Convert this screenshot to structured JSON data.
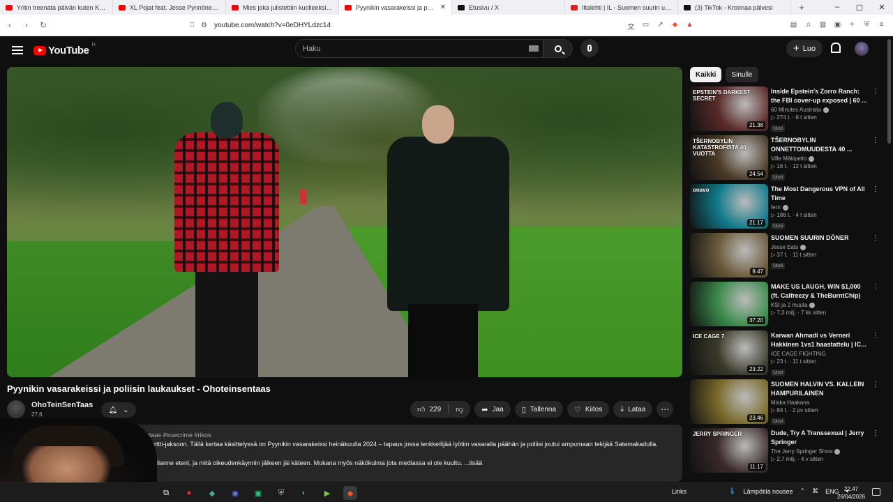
{
  "browser": {
    "tabs": [
      {
        "label": "Yritin treenata päivän kuten Klesbo -",
        "color": "#f00",
        "active": false
      },
      {
        "label": "XL Pojat feat. Jesse Pynnönen - You",
        "color": "#f00",
        "active": false
      },
      {
        "label": "Mies joka julistettiin kuolleeksi - mu",
        "color": "#f00",
        "active": false
      },
      {
        "label": "Pyynikin vasarakeissi ja polis",
        "color": "#f00",
        "active": true
      },
      {
        "label": "Etusivu / X",
        "color": "#111",
        "active": false
      },
      {
        "label": "Iltalehti | IL - Suomen suurin uutispal",
        "color": "#d22",
        "active": false
      },
      {
        "label": "(3) TikTok - Kroonaa pälvesi",
        "color": "#111",
        "active": false
      }
    ],
    "url": "youtube.com/watch?v=0eDHYLdzc14"
  },
  "masthead": {
    "logo_text": "YouTube",
    "region": "FI",
    "search_placeholder": "Haku",
    "create_label": "Luo"
  },
  "video": {
    "title": "Pyynikin vasarakeissi ja poliisin laukaukset - Ohoteinsentaas",
    "channel": "OhoTeinSenTaas",
    "subs": "27,6",
    "likes": "229",
    "share": "Jaa",
    "save": "Tallenna",
    "thanks": "Kiitos",
    "download": "Lataa",
    "desc_line1": "teinsentaas #truecrime #rikos",
    "desc_line2": "aporttti-jaksoon. Tällä kertaa käsittelyssä on Pyynikin vasarakeissi heinäkuulta 2024 – tapaus jossa lenkkeilijää lyötiin vasaralla päähän ja poliisi joutui ampumaan tekijää Satamakadulla.",
    "desc_line3": "en tilanne eteni, ja mitä oikeudenkäynnin jälkeen jäi käteen. Mukana myös näkökulma jota mediassa ei ole kuultu. ...lisää"
  },
  "chips": [
    "Kaikki",
    "Sinulle"
  ],
  "recommendations": [
    {
      "title": "Inside Epstein's Zorro Ranch: the FBI cover-up exposed | 60 ...",
      "channel": "60 Minutes Australia",
      "verified": true,
      "meta": "274 t. · 8 t sitten",
      "badge": "Uusi",
      "duration": "21.38",
      "thumb_text": "EPSTEIN'S DARKEST SECRET",
      "bg": "#5a2a2a"
    },
    {
      "title": "TŠERNOBYLIN ONNETTOMUUDESTA 40 ...",
      "channel": "Ville Mäkipelto",
      "verified": true,
      "meta": "16 t. · 12 t sitten",
      "badge": "Uusi",
      "duration": "24.54",
      "thumb_text": "TŠERNOBYLIN KATASTROFISTA 40 VUOTTA",
      "bg": "#4a3a26"
    },
    {
      "title": "The Most Dangerous VPN of All Time",
      "channel": "fern",
      "verified": true,
      "meta": "186 t. · 4 t sitten",
      "badge": "Uusi",
      "duration": "21.17",
      "thumb_text": "onavo",
      "bg": "#0f7a8a"
    },
    {
      "title": "SUOMEN SUURIN DÖNER",
      "channel": "Jesse Eats",
      "verified": true,
      "meta": "37 t. · 11 t sitten",
      "badge": "Uusi",
      "duration": "9.47",
      "thumb_text": "",
      "bg": "#6a5a3a"
    },
    {
      "title": "MAKE US LAUGH, WIN $1,000 (ft. Calfreezy & TheBurntChip)",
      "channel": "KSI ja 2 muuta",
      "verified": true,
      "meta": "7,3 milj. · 7 kk sitten",
      "badge": "",
      "duration": "37.20",
      "thumb_text": "",
      "bg": "#3a8a4a"
    },
    {
      "title": "Karwan Ahmadi vs Verneri Hakkinen 1vs1 haastattelu | IC...",
      "channel": "ICE CAGE FIGHTING",
      "verified": false,
      "meta": "23 t. · 11 t sitten",
      "badge": "Uusi",
      "duration": "23.22",
      "thumb_text": "ICE CAGE 7",
      "bg": "#3a3a2a"
    },
    {
      "title": "SUOMEN HALVIN VS. KALLEIN HAMPURILAINEN",
      "channel": "Miska Haakana",
      "verified": false,
      "meta": "84 t. · 2 pv sitten",
      "badge": "Uusi",
      "duration": "23.46",
      "thumb_text": "",
      "bg": "#7a6a2a"
    },
    {
      "title": "Dude, Try A Transsexual | Jerry Springer",
      "channel": "The Jerry Springer Show",
      "verified": true,
      "meta": "2,7 milj. · 4 v sitten",
      "badge": "",
      "duration": "11.17",
      "thumb_text": "JERRY SPRINGER",
      "bg": "#3a2a2a"
    }
  ],
  "taskbar": {
    "links": "Links",
    "weather": "Lämpötila nousee",
    "lang": "ENG",
    "time": "22.47",
    "date": "26/04/2026"
  }
}
